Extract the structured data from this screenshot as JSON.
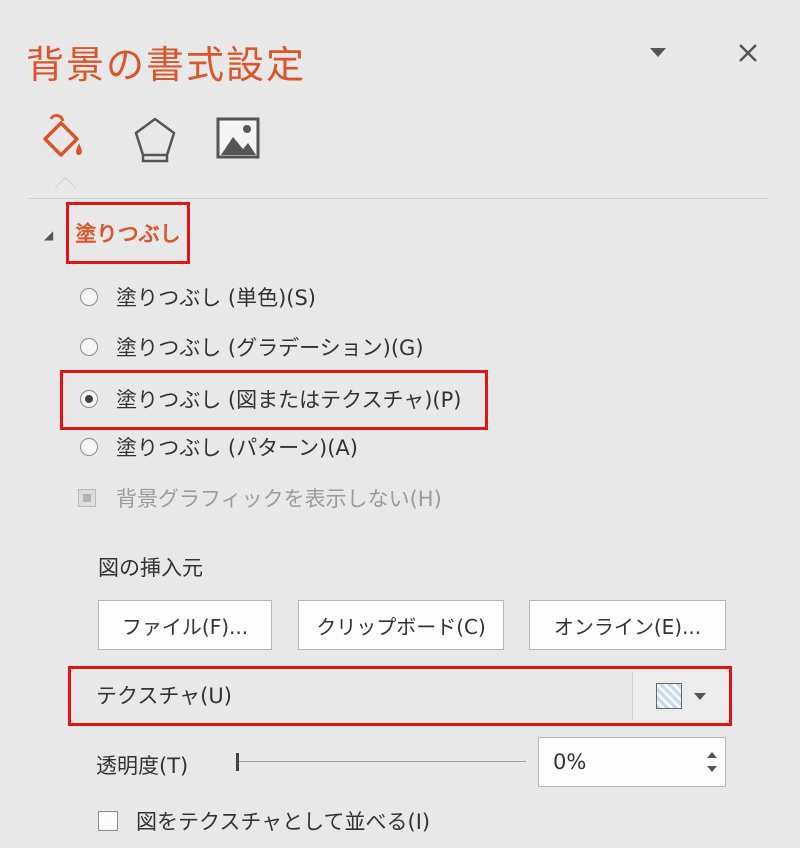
{
  "panel": {
    "title": "背景の書式設定",
    "accent_color": "#d9552b",
    "highlight_color": "#e01616",
    "header_icons": [
      "chevron-down-icon",
      "close-icon"
    ],
    "tabs": [
      {
        "icon": "paint-bucket-icon",
        "active": true
      },
      {
        "icon": "pentagon-icon",
        "active": false
      },
      {
        "icon": "picture-icon",
        "active": false
      }
    ]
  },
  "fill_section": {
    "title": "塗りつぶし",
    "options": [
      {
        "label": "塗りつぶし (単色)(S)",
        "checked": false
      },
      {
        "label": "塗りつぶし (グラデーション)(G)",
        "checked": false
      },
      {
        "label": "塗りつぶし (図またはテクスチャ)(P)",
        "checked": true
      },
      {
        "label": "塗りつぶし (パターン)(A)",
        "checked": false
      }
    ],
    "hide_background_graphics": "背景グラフィックを表示しない(H)",
    "insert_from_label": "図の挿入元",
    "buttons": {
      "file": "ファイル(F)...",
      "clipboard": "クリップボード(C)",
      "online": "オンライン(E)..."
    },
    "texture_label": "テクスチャ(U)",
    "transparency_label": "透明度(T)",
    "transparency_value": "0%",
    "transparency_level": 0,
    "tile_label": "図をテクスチャとして並べる(I)",
    "tile_checked": false
  }
}
